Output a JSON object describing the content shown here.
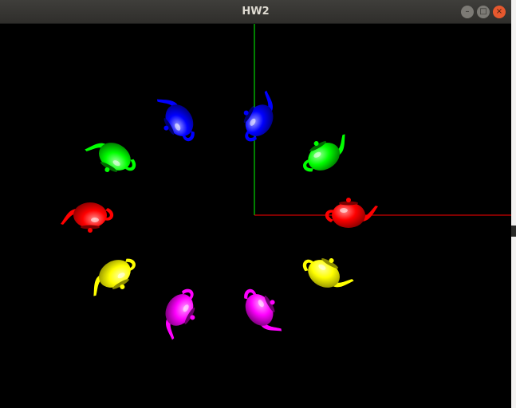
{
  "window": {
    "title": "HW2",
    "buttons": {
      "minimize_glyph": "–",
      "maximize_glyph": "□",
      "close_glyph": "×"
    }
  },
  "scene": {
    "background": "#000000",
    "axes": {
      "x_color": "#ff0000",
      "y_color": "#00ff00"
    },
    "teapots": [
      {
        "color": "red"
      },
      {
        "color": "yellow"
      },
      {
        "color": "magenta"
      },
      {
        "color": "magenta"
      },
      {
        "color": "yellow"
      },
      {
        "color": "red"
      },
      {
        "color": "green"
      },
      {
        "color": "blue"
      },
      {
        "color": "blue"
      },
      {
        "color": "green"
      }
    ]
  }
}
